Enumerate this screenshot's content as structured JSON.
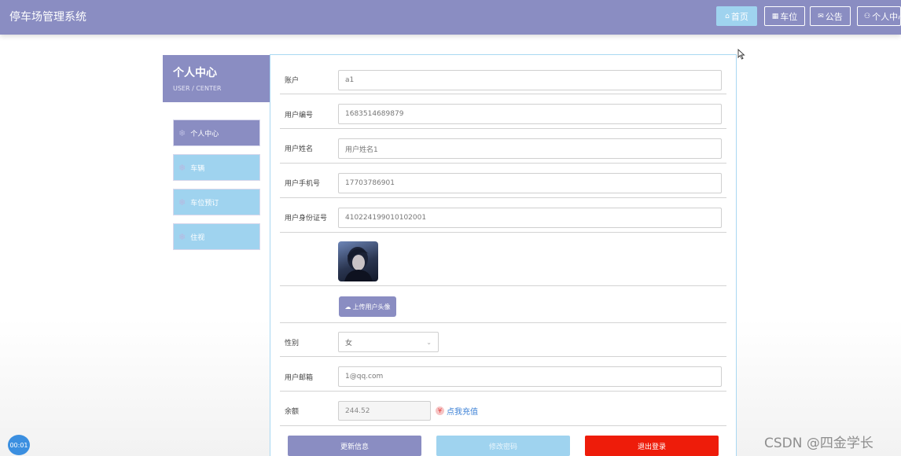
{
  "header": {
    "app_title": "停车场管理系统",
    "nav": [
      {
        "label": "首页",
        "icon": "home-icon",
        "active": true
      },
      {
        "label": "车位",
        "icon": "grid-icon",
        "active": false
      },
      {
        "label": "公告",
        "icon": "mail-icon",
        "active": false
      },
      {
        "label": "个人中心",
        "icon": "user-icon",
        "active": false
      }
    ]
  },
  "sidebar": {
    "title": "个人中心",
    "subtitle": "USER / CENTER",
    "items": [
      {
        "label": "个人中心",
        "icon": "snowflake-icon",
        "active": true
      },
      {
        "label": "车辆",
        "icon": "snowflake-icon",
        "active": false
      },
      {
        "label": "车位预订",
        "icon": "snowflake-icon",
        "active": false
      },
      {
        "label": "住视",
        "icon": "snowflake-icon",
        "active": false
      }
    ]
  },
  "form": {
    "account_label": "账户",
    "account_value": "a1",
    "user_no_label": "用户编号",
    "user_no_value": "1683514689879",
    "user_name_label": "用户姓名",
    "user_name_placeholder": "用户姓名1",
    "phone_label": "用户手机号",
    "phone_value": "17703786901",
    "id_card_label": "用户身份证号",
    "id_card_value": "410224199010102001",
    "upload_label": "上传用户头像",
    "gender_label": "性别",
    "gender_value": "女",
    "email_label": "用户邮箱",
    "email_value": "1@qq.com",
    "balance_label": "余额",
    "balance_value": "244.52",
    "recharge_label": "点我充值"
  },
  "actions": {
    "update_label": "更新信息",
    "middle_label": "修改密码",
    "logout_label": "退出登录"
  },
  "overlay": {
    "timer": "00:01",
    "watermark": "CSDN @四金学长"
  },
  "colors": {
    "primary": "#8a8dc2",
    "light_blue": "#9fd3ef",
    "danger": "#ee1c0a",
    "link": "#3a7fd5"
  }
}
